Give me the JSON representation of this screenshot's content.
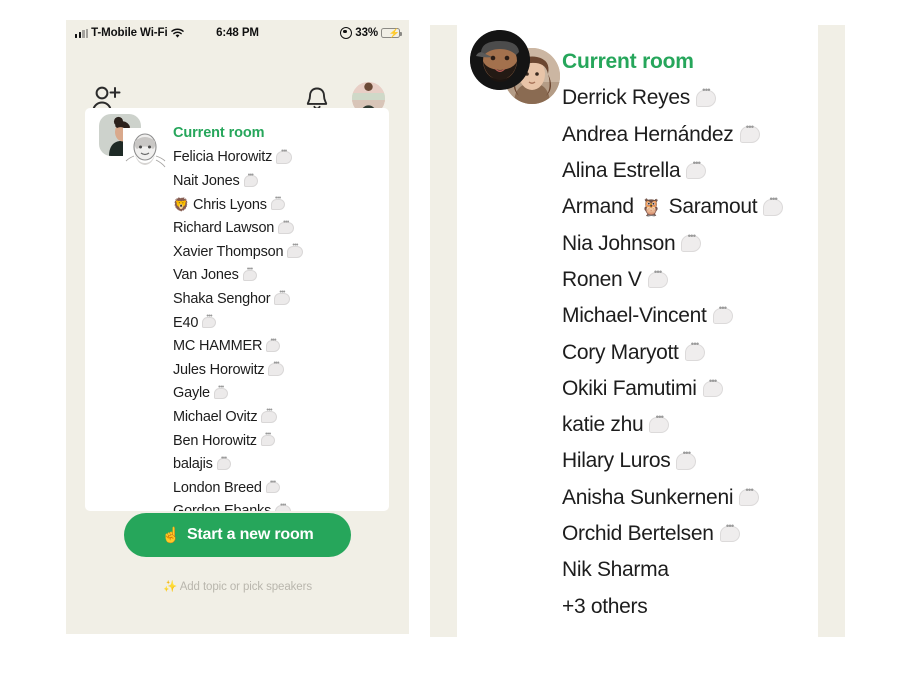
{
  "left_phone": {
    "status_bar": {
      "carrier": "T-Mobile Wi-Fi",
      "time": "6:48 PM",
      "battery_percent": "33%",
      "wifi_icon": "wifi-icon",
      "signal_icon": "cellular-signal-icon",
      "lock_icon": "location-lock-icon",
      "battery_icon": "battery-low-power-icon"
    },
    "nav": {
      "add_person_icon": "person-plus-icon",
      "bell_icon": "bell-icon",
      "profile_avatar": "profile-avatar"
    },
    "room_card": {
      "title": "Current room",
      "title_color": "#26a65b",
      "members": [
        {
          "emoji": "",
          "name": "Felicia Horowitz",
          "has_bubble": true
        },
        {
          "emoji": "",
          "name": "Nait Jones",
          "has_bubble": true
        },
        {
          "emoji": "🦁",
          "name": "Chris Lyons",
          "has_bubble": true
        },
        {
          "emoji": "",
          "name": "Richard Lawson",
          "has_bubble": true
        },
        {
          "emoji": "",
          "name": "Xavier Thompson",
          "has_bubble": true
        },
        {
          "emoji": "",
          "name": "Van Jones",
          "has_bubble": true
        },
        {
          "emoji": "",
          "name": "Shaka Senghor",
          "has_bubble": true
        },
        {
          "emoji": "",
          "name": "E40",
          "has_bubble": true
        },
        {
          "emoji": "",
          "name": "MC HAMMER",
          "has_bubble": true
        },
        {
          "emoji": "",
          "name": "Jules Horowitz",
          "has_bubble": true
        },
        {
          "emoji": "",
          "name": "Gayle",
          "has_bubble": true
        },
        {
          "emoji": "",
          "name": "Michael Ovitz",
          "has_bubble": true
        },
        {
          "emoji": "",
          "name": "Ben Horowitz",
          "has_bubble": true
        },
        {
          "emoji": "",
          "name": "balajis",
          "has_bubble": true
        },
        {
          "emoji": "",
          "name": "London Breed",
          "has_bubble": true
        },
        {
          "emoji": "",
          "name": "Gordon Ebanks",
          "has_bubble": true
        }
      ]
    },
    "start_room_button": {
      "emoji": "☝️",
      "label": "Start a new room",
      "color": "#26a65b"
    },
    "footer_hint": "✨ Add topic or pick speakers"
  },
  "right_panel": {
    "avatars": {
      "memoji": "memoji-avatar",
      "photo": "photo-avatar"
    },
    "title": "Current room",
    "title_color": "#26a65b",
    "members": [
      {
        "name": "Derrick Reyes",
        "has_bubble": true
      },
      {
        "name": "Andrea Hernández",
        "has_bubble": true
      },
      {
        "name": "Alina Estrella",
        "has_bubble": true
      },
      {
        "name": "Armand",
        "glyph": "🦉",
        "name_suffix": " Saramout",
        "has_bubble": true
      },
      {
        "name": "Nia Johnson",
        "has_bubble": true
      },
      {
        "name": "Ronen V",
        "has_bubble": true
      },
      {
        "name": "Michael-Vincent",
        "has_bubble": true
      },
      {
        "name": "Cory Maryott",
        "has_bubble": true
      },
      {
        "name": "Okiki Famutimi",
        "has_bubble": true
      },
      {
        "name": "katie zhu",
        "has_bubble": true
      },
      {
        "name": "Hilary Luros",
        "has_bubble": true
      },
      {
        "name": "Anisha Sunkerneni",
        "has_bubble": true
      },
      {
        "name": "Orchid Bertelsen",
        "has_bubble": true
      },
      {
        "name": "Nik Sharma",
        "has_bubble": false
      },
      {
        "name": "+3 others",
        "has_bubble": false
      }
    ]
  },
  "colors": {
    "page_background": "#ffffff",
    "phone_background": "#f1efe6",
    "card_background": "#ffffff",
    "accent_green": "#26a65b",
    "text_primary": "#1d1d1d",
    "text_muted": "#b9b6ad"
  }
}
